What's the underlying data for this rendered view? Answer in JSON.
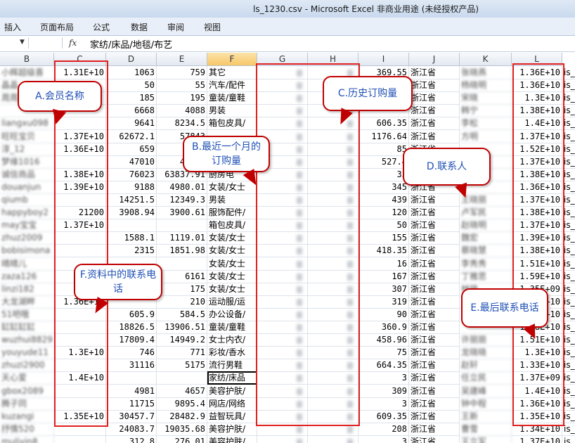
{
  "window": {
    "title": "ls_1230.csv - Microsoft Excel 非商业用途 (未经授权产品)"
  },
  "ribbon": {
    "tabs": [
      "插入",
      "页面布局",
      "公式",
      "数据",
      "审阅",
      "视图"
    ]
  },
  "formula_bar": {
    "fx_label": "fx",
    "value": "家纺/床品/地毯/布艺"
  },
  "columns": [
    "B",
    "C",
    "D",
    "E",
    "F",
    "G",
    "H",
    "I",
    "J",
    "K",
    "L"
  ],
  "rows": [
    [
      "小辉超级喜",
      "1.31E+10",
      "1063",
      "759",
      "其它",
      "",
      "",
      "369.55",
      "浙江省",
      "张晓燕",
      "1.36E+10",
      "is_"
    ],
    [
      "晶晶",
      "",
      "50",
      "55",
      "汽车/配件",
      "",
      "",
      "",
      "浙江省",
      "杨晓明",
      "1.36E+10",
      "is_"
    ],
    [
      "周周",
      "",
      "185",
      "195",
      "童装/童鞋",
      "",
      "",
      "",
      "浙江省",
      "宋晓",
      "1.3E+10",
      "is_"
    ],
    [
      "",
      "",
      "6668",
      "4088",
      "男装",
      "",
      "",
      "",
      "浙江省",
      "韩宁",
      "1.38E+10",
      "is_"
    ],
    [
      "liangxu098",
      "",
      "9641",
      "8234.5",
      "箱包皮具/",
      "",
      "",
      "606.35",
      "浙江省",
      "李松",
      "1.4E+10",
      "is_"
    ],
    [
      "旺旺宝贝",
      "1.37E+10",
      "62672.1",
      "57843",
      "",
      "",
      "",
      "1176.64",
      "浙江省",
      "方明",
      "1.37E+10",
      "is_"
    ],
    [
      "淳_12",
      "1.36E+10",
      "659",
      "",
      "",
      "",
      "",
      "85",
      "浙江省",
      "",
      "1.52E+10",
      "is_"
    ],
    [
      "梦缘1016",
      "",
      "47010",
      "41330",
      "",
      "",
      "",
      "527.4",
      "浙江省",
      "",
      "1.37E+10",
      "is_"
    ],
    [
      "诚信商品",
      "1.38E+10",
      "76023",
      "63837.91",
      "厨房电",
      "",
      "",
      "35",
      "浙江省",
      "",
      "1.38E+10",
      "is_"
    ],
    [
      "douanjun",
      "1.39E+10",
      "9188",
      "4980.01",
      "女装/女士",
      "",
      "",
      "345",
      "浙江省",
      "",
      "1.36E+10",
      "is_"
    ],
    [
      "qiumb",
      "",
      "14251.5",
      "12349.3",
      "男装",
      "",
      "",
      "439",
      "浙江省",
      "王晓丽",
      "1.37E+10",
      "is_"
    ],
    [
      "happyboy2",
      "21200",
      "3908.94",
      "3900.61",
      "服饰配件/",
      "",
      "",
      "120",
      "浙江省",
      "卢军民",
      "1.38E+10",
      "is_"
    ],
    [
      "may宝宝",
      "1.37E+10",
      "",
      "",
      "箱包皮具/",
      "",
      "",
      "50",
      "浙江省",
      "赵晓明",
      "1.37E+10",
      "is_"
    ],
    [
      "zhuz2009",
      "",
      "1588.1",
      "1119.01",
      "女装/女士",
      "",
      "",
      "155",
      "浙江省",
      "魏宏",
      "1.39E+10",
      "is_"
    ],
    [
      "bobisimona",
      "",
      "2315",
      "1851.98",
      "女装/女士",
      "",
      "",
      "418.35",
      "浙江省",
      "蔡晓慧",
      "1.38E+10",
      "is_"
    ],
    [
      "晴晴儿",
      "",
      "",
      "",
      "女装/女士",
      "",
      "",
      "16",
      "浙江省",
      "李秀秀",
      "1.51E+10",
      "is_"
    ],
    [
      "zaza126",
      "",
      "",
      "6161",
      "女装/女士",
      "",
      "",
      "167",
      "浙江省",
      "丁雅思",
      "1.59E+10",
      "is_"
    ],
    [
      "linzi182",
      "",
      "",
      "175",
      "女装/女士",
      "",
      "",
      "307",
      "浙江省",
      "林晓",
      "1.35E+09",
      "is_"
    ],
    [
      "大龙湖畔",
      "1.36E+10",
      "",
      "210",
      "运动服/运",
      "",
      "",
      "319",
      "浙江省",
      "",
      "1.36E+10",
      "is_"
    ],
    [
      "51吧哦",
      "",
      "605.9",
      "584.5",
      "办公设备/",
      "",
      "",
      "90",
      "浙江省",
      "",
      "1.37E+10",
      "is_"
    ],
    [
      "缸缸缸缸",
      "",
      "18826.5",
      "13906.51",
      "童装/童鞋",
      "",
      "",
      "360.9",
      "浙江省",
      "",
      "1.38E+10",
      "is_"
    ],
    [
      "wuzhui8829",
      "",
      "17809.4",
      "14949.2",
      "女士内衣/",
      "",
      "",
      "458.96",
      "浙江省",
      "许丽丽",
      "1.51E+10",
      "is_"
    ],
    [
      "youyude11",
      "1.3E+10",
      "746",
      "771",
      "彩妆/香水",
      "",
      "",
      "75",
      "浙江省",
      "龙晓晓",
      "1.3E+10",
      "is_"
    ],
    [
      "zhuzi2900",
      "",
      "31116",
      "5175",
      "流行男鞋",
      "",
      "",
      "664.35",
      "浙江省",
      "赵轩",
      "1.33E+10",
      "is_"
    ],
    [
      "天心爱",
      "1.4E+10",
      "",
      "",
      "家纺/床品",
      "",
      "",
      "3",
      "浙江省",
      "任立民",
      "1.37E+09",
      "is_"
    ],
    [
      "gbox2089",
      "",
      "4981",
      "4657",
      "美容护肤/",
      "",
      "",
      "309",
      "浙江省",
      "吴建峰",
      "1.4E+10",
      "is_"
    ],
    [
      "腾子同",
      "",
      "11715",
      "9895.4",
      "网店/网络",
      "",
      "",
      "3",
      "浙江省",
      "钟中程",
      "1.36E+10",
      "is_"
    ],
    [
      "kuzangi",
      "1.35E+10",
      "30457.7",
      "28482.9",
      "益智玩具/",
      "",
      "",
      "609.35",
      "浙江省",
      "王新",
      "1.35E+10",
      "is_"
    ],
    [
      "抒情520",
      "",
      "24083.7",
      "19035.68",
      "美容护肤/",
      "",
      "",
      "208",
      "浙江省",
      "曹雪",
      "1.34E+10",
      "is_"
    ],
    [
      "muliyin8",
      "",
      "312.8",
      "276.01",
      "美容护肤/",
      "",
      "",
      "3",
      "浙江省",
      "王立军",
      "1.37E+10",
      "is_"
    ]
  ],
  "callouts": {
    "a": "A.会员名称",
    "b": "B.最近一个月的订购量",
    "c": "C.历史订购量",
    "d": "D.联系人",
    "e": "E.最后联系电话",
    "f": "F.资料中的联系电话"
  }
}
